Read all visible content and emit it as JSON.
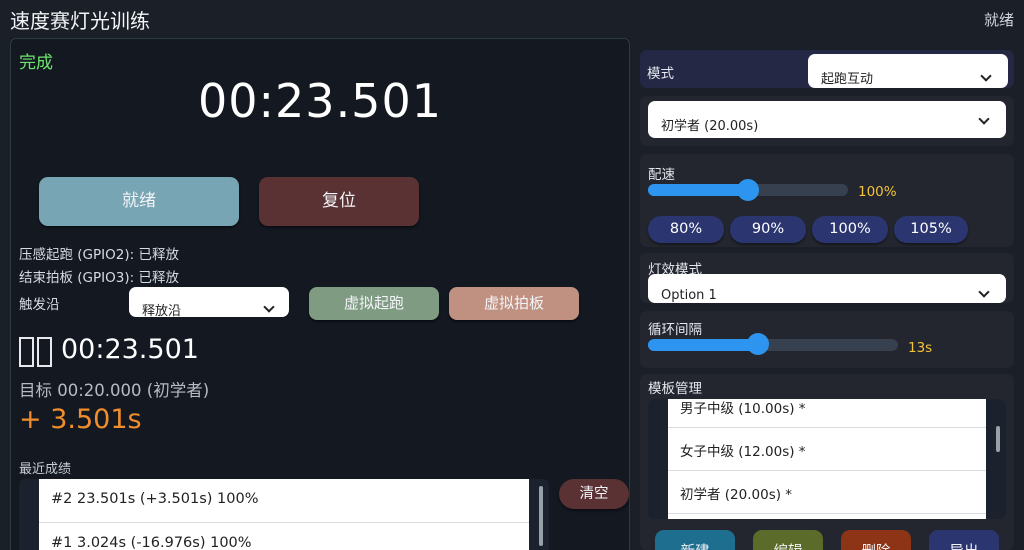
{
  "app": {
    "title": "速度赛灯光训练",
    "status": "就绪"
  },
  "timer": {
    "state": "完成",
    "display": "00:23.501",
    "ready_label": "就绪",
    "reset_label": "复位"
  },
  "sensors": {
    "start": "压感起跑 (GPIO2): 已释放",
    "end": "结束拍板 (GPIO3): 已释放",
    "edge_label": "触发沿",
    "edge_value": "释放沿",
    "virtual_start_label": "虚拟起跑",
    "virtual_end_label": "虚拟拍板"
  },
  "result": {
    "time": "00:23.501",
    "target": "目标 00:20.000 (初学者)",
    "delta": "+ 3.501s"
  },
  "recent": {
    "label": "最近成绩",
    "items": [
      "#2 23.501s (+3.501s) 100%",
      "#1 3.024s (-16.976s) 100%"
    ],
    "clear_label": "清空"
  },
  "settings": {
    "mode_label": "模式",
    "mode_value": "起跑互动",
    "level_value": "初学者 (20.00s)",
    "pace_label": "配速",
    "pace_value": "100%",
    "pace_fraction": 0.5,
    "pace_presets": [
      "80%",
      "90%",
      "100%",
      "105%"
    ],
    "effect_label": "灯效模式",
    "effect_value": "Option 1",
    "loop_label": "循环间隔",
    "loop_value": "13s",
    "loop_fraction": 0.44
  },
  "templates": {
    "label": "模板管理",
    "items": [
      "男子中级 (10.00s) *",
      "女子中级 (12.00s) *",
      "初学者 (20.00s) *"
    ],
    "new_label": "新建",
    "edit_label": "编辑",
    "delete_label": "删除",
    "export_label": "导出"
  },
  "colors": {
    "accent": "#2d95ef",
    "success": "#6ee36e",
    "delta": "#f08d2c",
    "value": "#f3c43a"
  }
}
